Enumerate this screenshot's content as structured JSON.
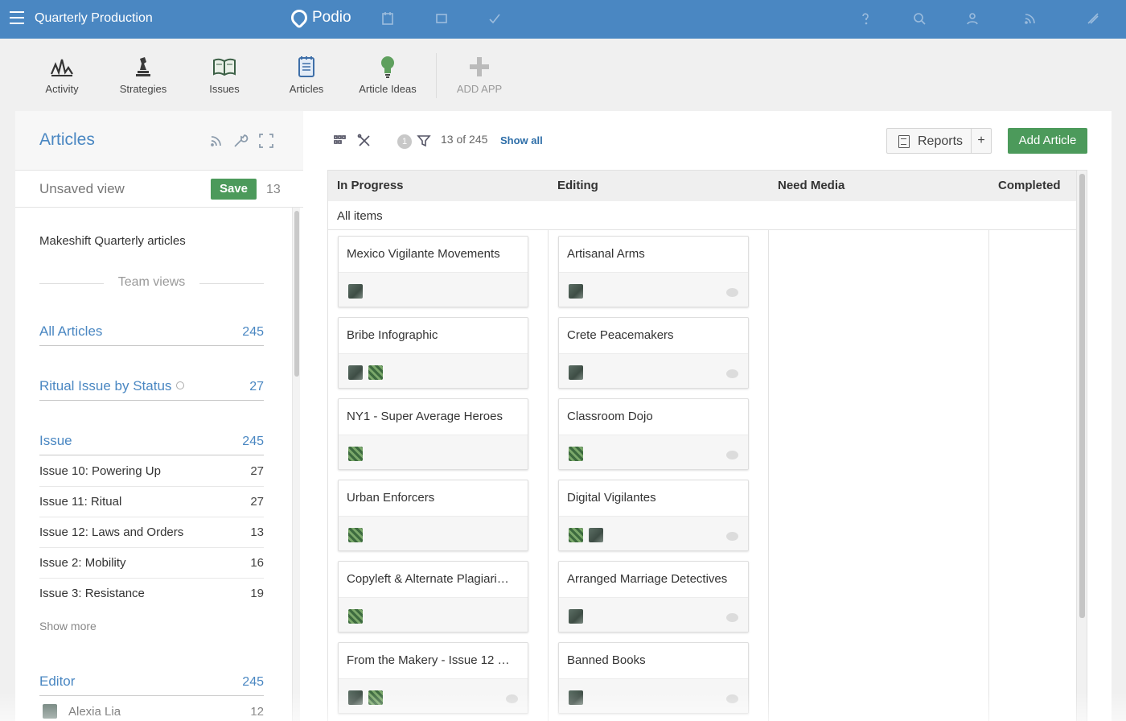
{
  "topbar": {
    "workspace": "Quarterly Production",
    "logo": "Podio",
    "icons": [
      "calendar-icon",
      "square-icon",
      "check-icon",
      "help-icon",
      "search-icon",
      "user-icon",
      "feed-icon",
      "sliders-icon"
    ]
  },
  "apps": [
    {
      "label": "Activity",
      "icon": "activity-icon"
    },
    {
      "label": "Strategies",
      "icon": "chess-icon"
    },
    {
      "label": "Issues",
      "icon": "book-icon"
    },
    {
      "label": "Articles",
      "icon": "notepad-icon"
    },
    {
      "label": "Article Ideas",
      "icon": "lightbulb-icon"
    },
    {
      "label": "ADD APP",
      "icon": "plus-icon"
    }
  ],
  "sidebar": {
    "title": "Articles",
    "view_name": "Unsaved view",
    "save_label": "Save",
    "view_count": "13",
    "org_name": "Makeshift Quarterly articles",
    "team_views_label": "Team views",
    "all_articles": {
      "label": "All Articles",
      "count": "245"
    },
    "ritual_issue": {
      "label": "Ritual Issue by Status",
      "count": "27"
    },
    "issue_header": {
      "label": "Issue",
      "count": "245"
    },
    "issues": [
      {
        "label": "Issue 10: Powering Up",
        "count": "27"
      },
      {
        "label": "Issue 11: Ritual",
        "count": "27"
      },
      {
        "label": "Issue 12: Laws and Orders",
        "count": "13"
      },
      {
        "label": "Issue 2: Mobility",
        "count": "16"
      },
      {
        "label": "Issue 3: Resistance",
        "count": "19"
      }
    ],
    "show_more": "Show more",
    "editor_header": {
      "label": "Editor",
      "count": "245"
    },
    "editors": [
      {
        "label": "Alexia Lia",
        "count": "12"
      }
    ]
  },
  "main": {
    "filter_badge": "1",
    "count_text": "13 of 245",
    "show_all": "Show all",
    "reports_label": "Reports",
    "plus_label": "+",
    "add_article_label": "Add Article",
    "group_label": "All items",
    "columns": [
      {
        "title": "In Progress"
      },
      {
        "title": "Editing"
      },
      {
        "title": "Need Media"
      },
      {
        "title": "Completed"
      }
    ],
    "cards_in_progress": [
      {
        "title": "Mexico Vigilante Movements",
        "avatars": [
          "person"
        ],
        "comments": false
      },
      {
        "title": "Bribe Infographic",
        "avatars": [
          "person",
          "green"
        ],
        "comments": false
      },
      {
        "title": "NY1 - Super Average Heroes",
        "avatars": [
          "green"
        ],
        "comments": false
      },
      {
        "title": "Urban Enforcers",
        "avatars": [
          "green"
        ],
        "comments": false
      },
      {
        "title": "Copyleft & Alternate Plagiari…",
        "avatars": [
          "green"
        ],
        "comments": false
      },
      {
        "title": "From the Makery - Issue 12 …",
        "avatars": [
          "person",
          "green"
        ],
        "comments": true
      }
    ],
    "cards_editing": [
      {
        "title": "Artisanal Arms",
        "avatars": [
          "person"
        ],
        "comments": true
      },
      {
        "title": "Crete Peacemakers",
        "avatars": [
          "person"
        ],
        "comments": true
      },
      {
        "title": "Classroom Dojo",
        "avatars": [
          "green"
        ],
        "comments": true
      },
      {
        "title": "Digital Vigilantes",
        "avatars": [
          "green",
          "person"
        ],
        "comments": true
      },
      {
        "title": "Arranged Marriage Detectives",
        "avatars": [
          "person"
        ],
        "comments": true
      },
      {
        "title": "Banned Books",
        "avatars": [
          "person"
        ],
        "comments": true
      }
    ]
  },
  "colors": {
    "brand_blue": "#4a87c2",
    "save_green": "#4c9a5b",
    "link_blue": "#2e6ea8"
  }
}
